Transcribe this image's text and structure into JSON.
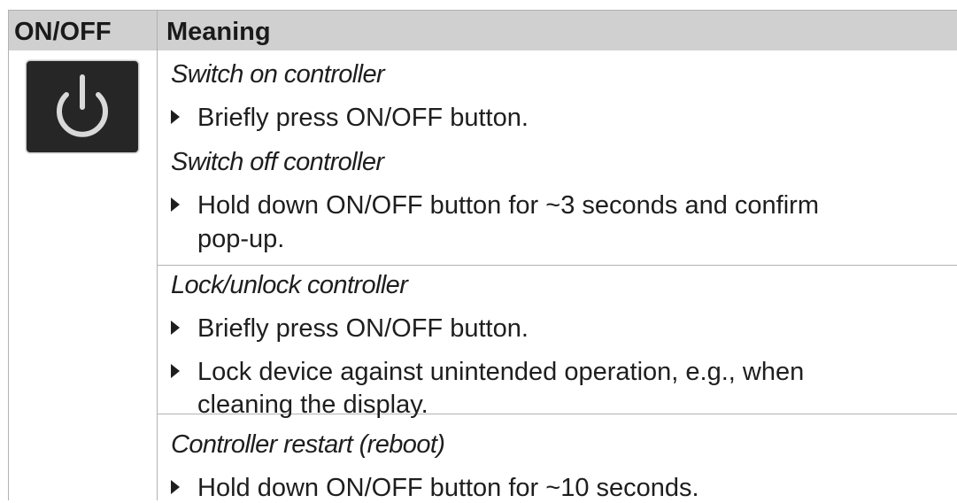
{
  "header": {
    "col1": "ON/OFF",
    "col2": "Meaning"
  },
  "icon": {
    "name": "power-icon",
    "button_bg": "#262626",
    "symbol_color": "#d9d9d9"
  },
  "sections": [
    {
      "title": "Switch on controller",
      "steps": [
        "Briefly press ON/OFF button."
      ]
    },
    {
      "title": "Switch off controller",
      "steps": [
        "Hold down ON/OFF button for ~3 seconds and confirm"
      ],
      "continuation": "pop-up."
    },
    {
      "title": "Lock/unlock controller",
      "steps": [
        "Briefly press ON/OFF button.",
        "Lock device against unintended operation, e.g., when"
      ],
      "continuation": "cleaning the display."
    },
    {
      "title": "Controller restart (reboot)",
      "steps": [
        "Hold down ON/OFF button for ~10 seconds."
      ]
    }
  ],
  "colors": {
    "header_bg": "#d0d0d0",
    "rule": "#b2b2b2",
    "text": "#1e1e1e"
  }
}
